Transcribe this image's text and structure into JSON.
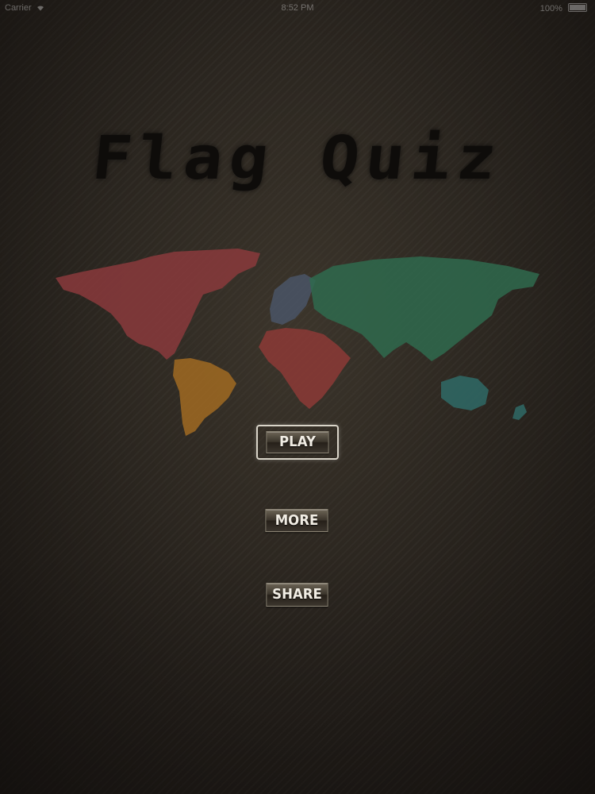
{
  "status_bar": {
    "carrier": "Carrier",
    "time": "8:52 PM",
    "battery": "100%"
  },
  "title": "Flag Quiz",
  "map": {
    "icon": "world-map-icon",
    "colors": {
      "north_america": "#8a3a3c",
      "south_america": "#a06a22",
      "europe": "#4a5566",
      "africa": "#8c3a36",
      "asia": "#2f6a4e",
      "australia": "#2f6a66"
    }
  },
  "menu": {
    "play_label": "PLAY",
    "more_label": "MORE",
    "share_label": "SHARE"
  }
}
